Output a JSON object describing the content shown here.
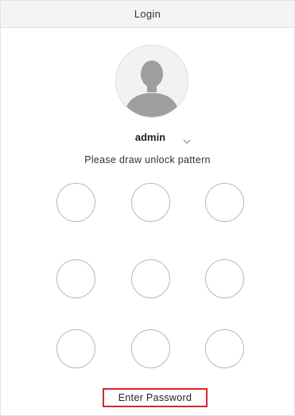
{
  "window": {
    "title": "Login"
  },
  "user": {
    "name": "admin",
    "dropdown_icon": "chevron-down-icon",
    "avatar_icon": "user-avatar-icon"
  },
  "pattern": {
    "prompt": "Please draw unlock pattern",
    "rows": 3,
    "cols": 3
  },
  "actions": {
    "enter_password_label": "Enter Password"
  },
  "colors": {
    "highlight_border": "#d9262e",
    "avatar_silhouette": "#9e9e9e",
    "dot_border": "#b9b9b9"
  }
}
